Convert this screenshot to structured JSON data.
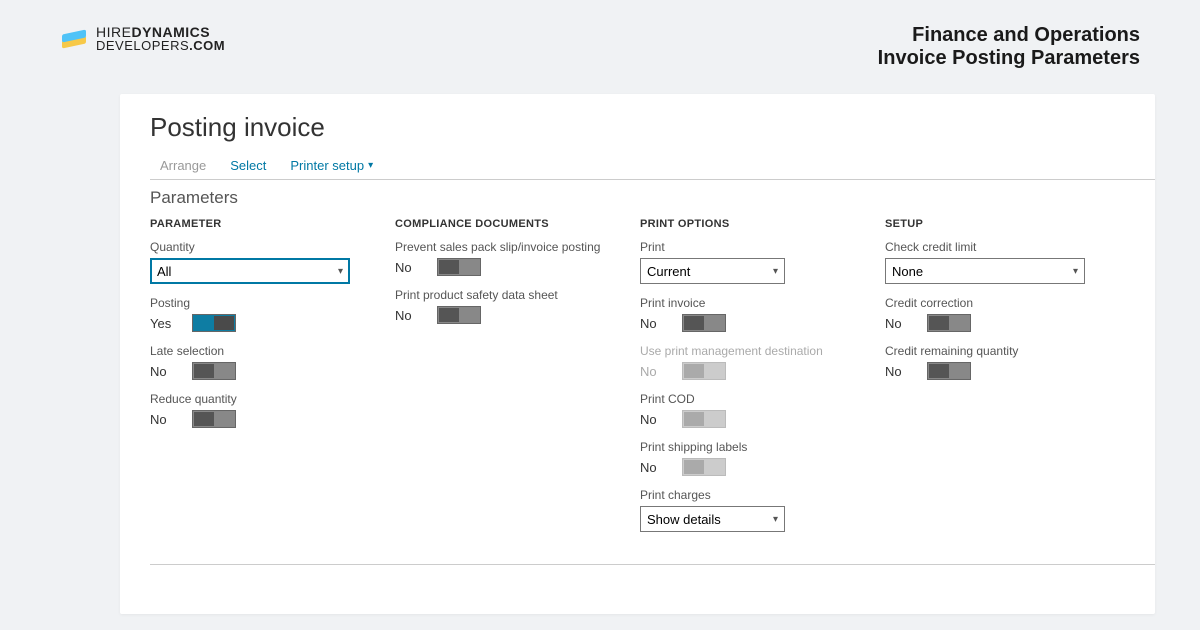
{
  "logo": {
    "line1_pre": "HIRE",
    "line1_bold": "DYNAMICS",
    "line2_pre": "DEVELOPERS",
    "line2_bold": ".COM"
  },
  "header": {
    "line1": "Finance and Operations",
    "line2": "Invoice Posting Parameters"
  },
  "app": {
    "title": "Posting invoice"
  },
  "tabs": {
    "arrange": "Arrange",
    "select": "Select",
    "printer": "Printer setup"
  },
  "section": {
    "parameters": "Parameters"
  },
  "colHeaders": {
    "parameter": "PARAMETER",
    "compliance": "COMPLIANCE DOCUMENTS",
    "print": "PRINT OPTIONS",
    "setup": "SETUP"
  },
  "col1": {
    "quantity": {
      "label": "Quantity",
      "value": "All"
    },
    "posting": {
      "label": "Posting",
      "state": "Yes"
    },
    "lateSelection": {
      "label": "Late selection",
      "state": "No"
    },
    "reduceQty": {
      "label": "Reduce quantity",
      "state": "No"
    }
  },
  "col2": {
    "prevent": {
      "label": "Prevent sales pack slip/invoice posting",
      "state": "No"
    },
    "safety": {
      "label": "Print product safety data sheet",
      "state": "No"
    }
  },
  "col3": {
    "print": {
      "label": "Print",
      "value": "Current"
    },
    "printInvoice": {
      "label": "Print invoice",
      "state": "No"
    },
    "usePrintMgmt": {
      "label": "Use print management destination",
      "state": "No"
    },
    "printCOD": {
      "label": "Print COD",
      "state": "No"
    },
    "printShipping": {
      "label": "Print shipping labels",
      "state": "No"
    },
    "printCharges": {
      "label": "Print charges",
      "value": "Show details"
    }
  },
  "col4": {
    "checkCredit": {
      "label": "Check credit limit",
      "value": "None"
    },
    "creditCorrection": {
      "label": "Credit correction",
      "state": "No"
    },
    "creditRemaining": {
      "label": "Credit remaining quantity",
      "state": "No"
    }
  }
}
